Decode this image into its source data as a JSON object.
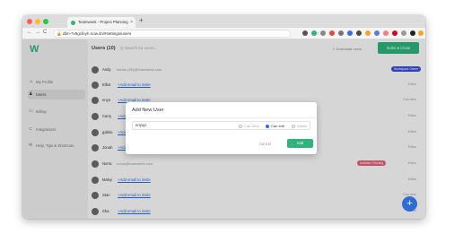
{
  "browser": {
    "tab_title": "Teamweek - Project Planning",
    "tab_close": "×",
    "new_tab": "+",
    "url": "dbri-7x9gcfeyh.now.sh/#settings/users",
    "nav": {
      "back": "←",
      "forward": "→",
      "reload": "C"
    }
  },
  "sidebar": {
    "logo": "W",
    "items": [
      {
        "label": "My Profile",
        "icon": "person-icon",
        "glyph": "☺"
      },
      {
        "label": "Users",
        "icon": "users-icon",
        "glyph": "♟",
        "active": true
      },
      {
        "label": "Billing",
        "icon": "card-icon",
        "glyph": "▭"
      },
      {
        "label": "Integrations",
        "icon": "plug-icon",
        "glyph": "⊂"
      },
      {
        "label": "Help, Tips & Shortcuts",
        "icon": "chat-icon",
        "glyph": "✉"
      }
    ]
  },
  "header": {
    "title": "Users (10)",
    "search_icon": "Q",
    "search_placeholder": "Search for users...",
    "download": "Download users",
    "download_icon": "⇩",
    "invite": "Invite & Close"
  },
  "users": [
    {
      "name": "Andy",
      "email": "banas-(99)@teamweek.com",
      "role": "Workspace Owner",
      "badge": true,
      "badge_color": "#3b4fd6"
    },
    {
      "name": "Elliot",
      "link": "+Add email to invite",
      "role": "Editor"
    },
    {
      "name": "enyo",
      "link": "+Add email to invite",
      "role": "Can view"
    },
    {
      "name": "Carry",
      "link": "+Add em",
      "role": "Editor"
    },
    {
      "name": "gabrie",
      "link": "+Add e",
      "role": "Editor"
    },
    {
      "name": "Jonah",
      "link": "+Add e",
      "role": "Editor"
    },
    {
      "name": "Norra",
      "email": "norra@teamweek.com",
      "role": "Editor",
      "status": "Invitation Pending",
      "status_color": "#e5607a"
    },
    {
      "name": "Malvy",
      "link": "+Add email to invite",
      "role": "Editor"
    },
    {
      "name": "Stan",
      "link": "+Add email to invite",
      "role": "Can view"
    },
    {
      "name": "Sha",
      "link": "+Add email to invite",
      "role": "Editor"
    }
  ],
  "modal": {
    "title": "Add New User",
    "value": "enyop",
    "options": [
      "Can view",
      "Can edit",
      "Admin"
    ],
    "selected": "Can edit",
    "cancel": "Cancel",
    "add": "Add"
  },
  "fab": "+"
}
